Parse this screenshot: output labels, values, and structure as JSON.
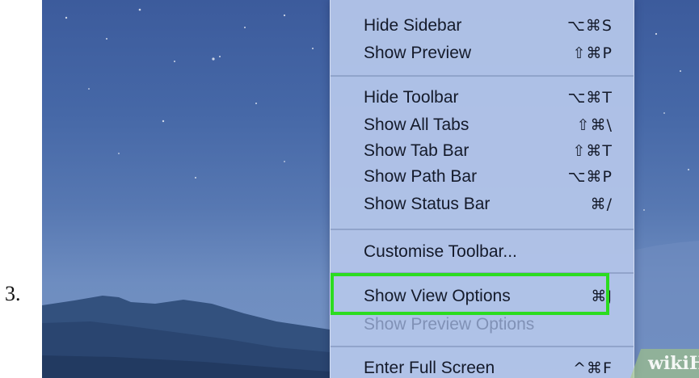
{
  "step": {
    "number": "3."
  },
  "menu": {
    "groups": [
      {
        "items": [
          {
            "label": "Hide Sidebar",
            "shortcut": "⌥⌘S"
          },
          {
            "label": "Show Preview",
            "shortcut": "⇧⌘P"
          }
        ]
      },
      {
        "items": [
          {
            "label": "Hide Toolbar",
            "shortcut": "⌥⌘T"
          },
          {
            "label": "Show All Tabs",
            "shortcut": "⇧⌘\\"
          },
          {
            "label": "Show Tab Bar",
            "shortcut": "⇧⌘T"
          },
          {
            "label": "Show Path Bar",
            "shortcut": "⌥⌘P"
          },
          {
            "label": "Show Status Bar",
            "shortcut": "⌘/"
          }
        ]
      },
      {
        "items": [
          {
            "label": "Customise Toolbar...",
            "shortcut": ""
          }
        ]
      },
      {
        "items": [
          {
            "label": "Show View Options",
            "shortcut": "⌘J",
            "highlighted": true
          },
          {
            "label": "Show Preview Options",
            "shortcut": "",
            "disabled": true
          }
        ]
      },
      {
        "items": [
          {
            "label": "Enter Full Screen",
            "shortcut": "^⌘F"
          }
        ]
      }
    ]
  },
  "highlight_color": "#2bdc20",
  "watermark": {
    "text": "wikiHow"
  }
}
